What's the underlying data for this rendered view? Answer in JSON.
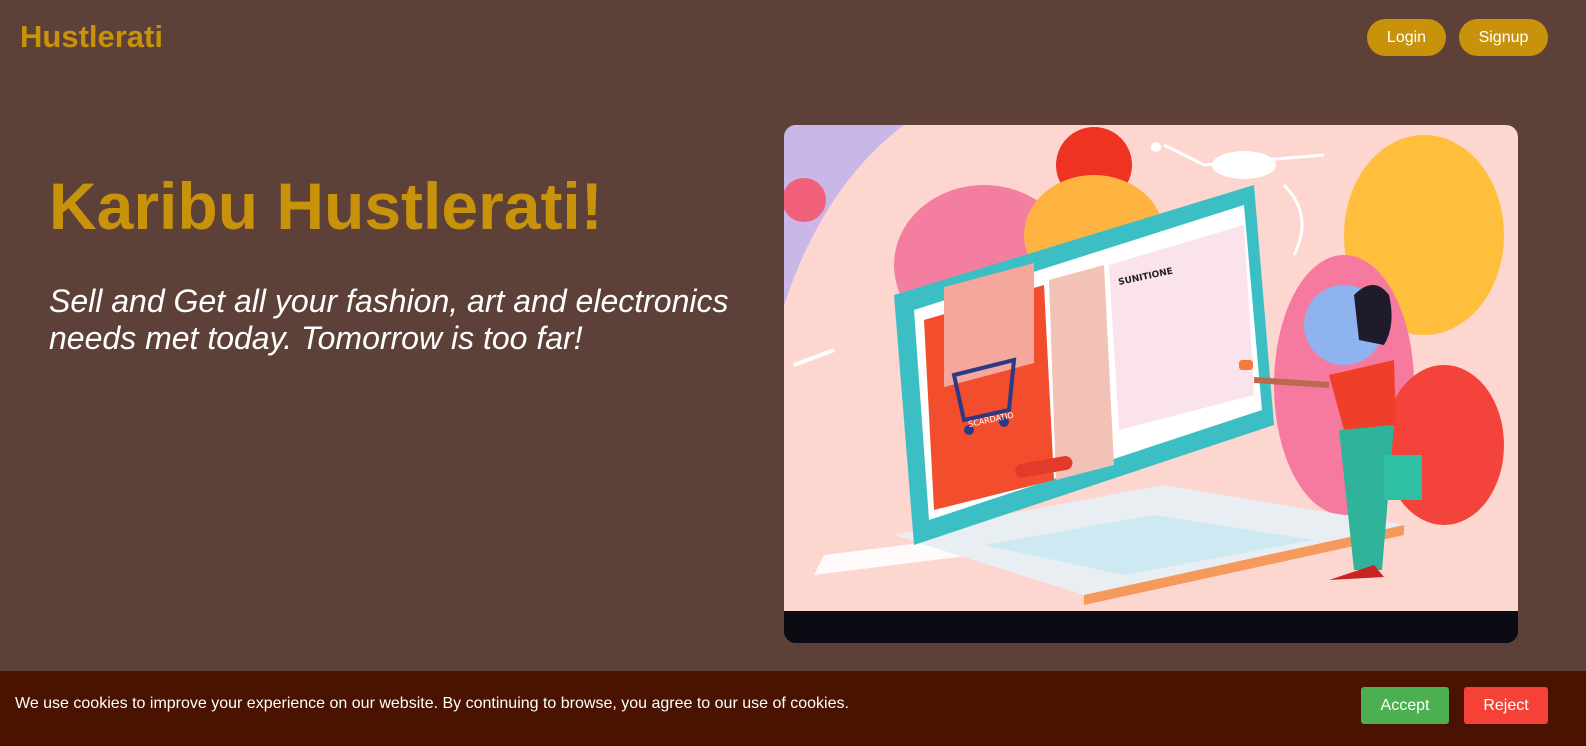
{
  "header": {
    "brand": "Hustlerati",
    "login_label": "Login",
    "signup_label": "Signup"
  },
  "hero": {
    "title": "Karibu Hustlerati!",
    "tagline": "Sell and Get all your fashion, art and electronics needs met today. Tomorrow is too far!",
    "illustration": {
      "alt": "Illustration of a woman shopping online on a large laptop",
      "screen_text": [
        "SUNITIONE",
        "SCARDATIO"
      ]
    }
  },
  "cookie_banner": {
    "message": "We use cookies to improve your experience on our website. By continuing to browse, you agree to our use of cookies.",
    "accept_label": "Accept",
    "reject_label": "Reject"
  },
  "colors": {
    "background": "#5d4037",
    "accent": "#c8930a",
    "cookie_bar": "#4a1200",
    "accept": "#4caf50",
    "reject": "#f44336"
  }
}
